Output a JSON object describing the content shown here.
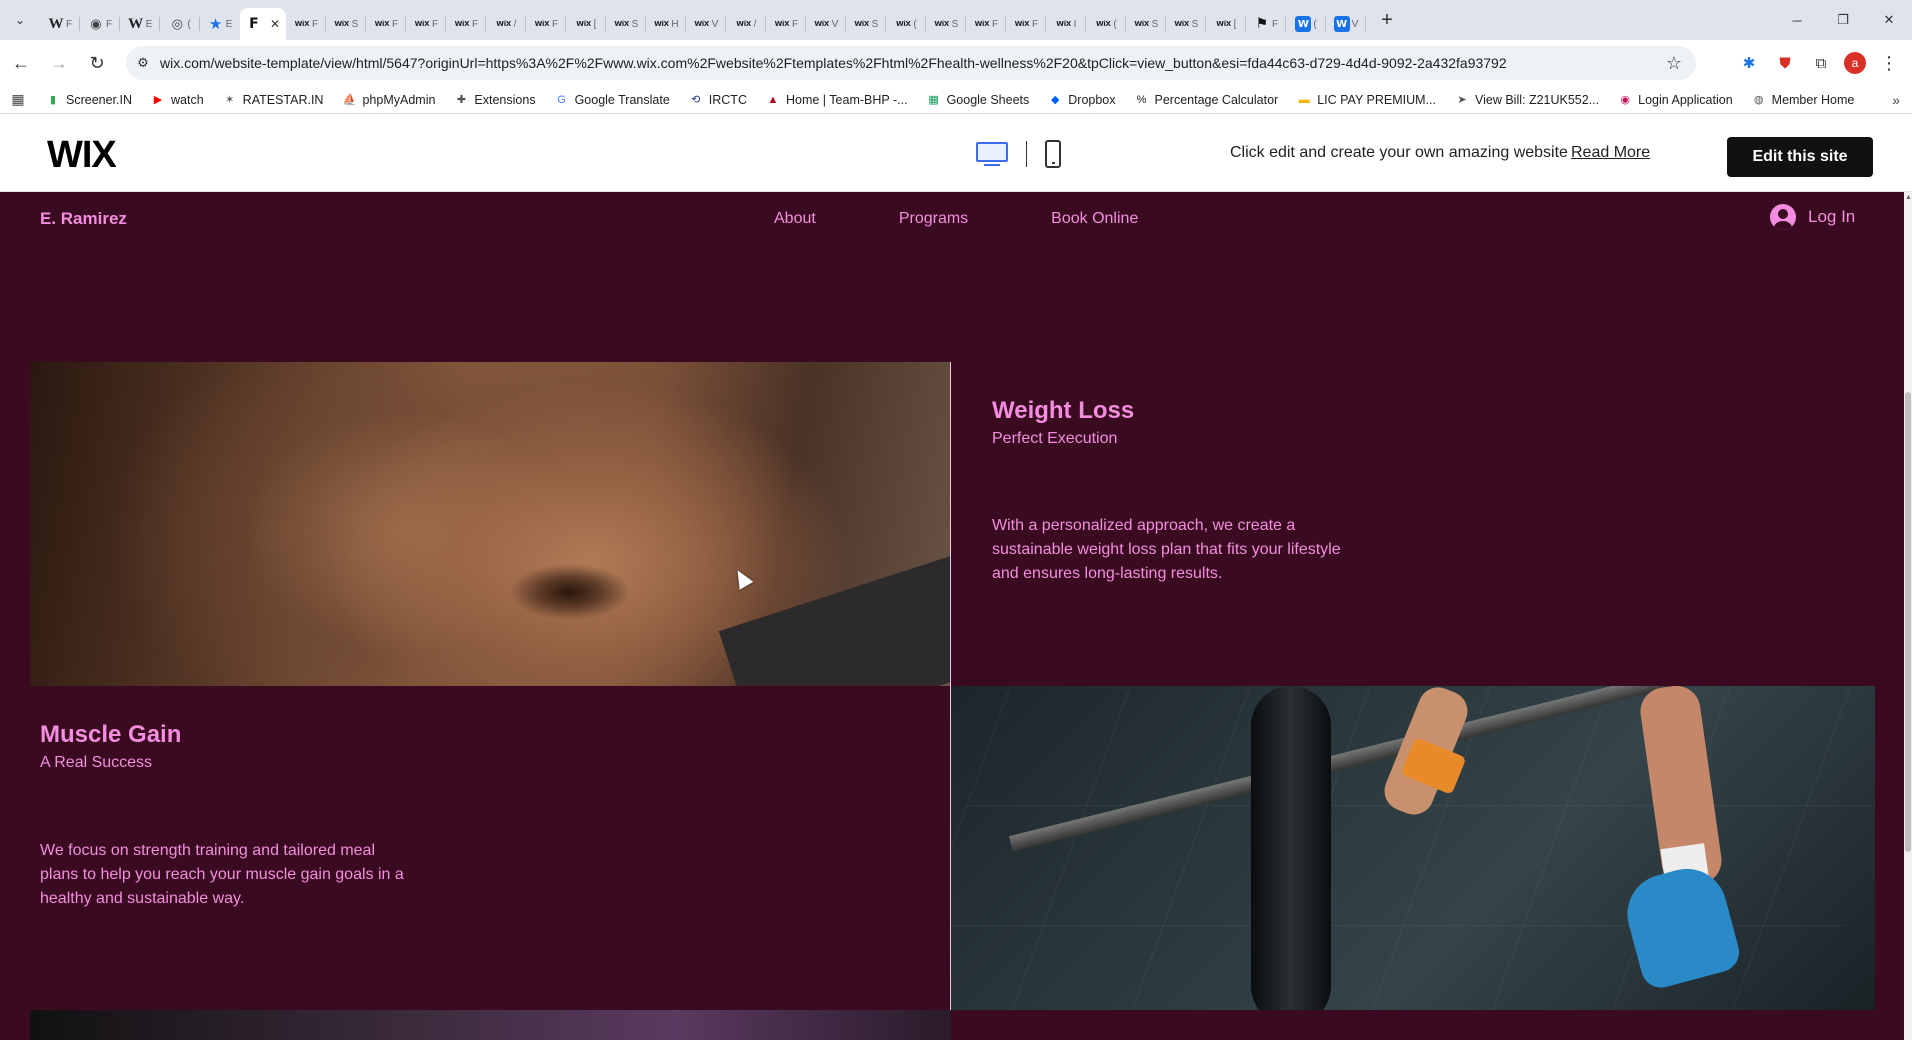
{
  "browser": {
    "tabs": [
      {
        "icon": "W",
        "icon_class": "w",
        "label": "F"
      },
      {
        "icon": "◉",
        "icon_class": "globe",
        "label": "F"
      },
      {
        "icon": "W",
        "icon_class": "w",
        "label": "E"
      },
      {
        "icon": "◎",
        "icon_class": "globe",
        "label": "("
      },
      {
        "icon": "★",
        "icon_class": "star",
        "label": "E"
      },
      {
        "icon": "F",
        "icon_class": "dark",
        "label": "",
        "active": true
      },
      {
        "icon": "WiX",
        "icon_class": "wix",
        "label": "F"
      },
      {
        "icon": "WiX",
        "icon_class": "wix",
        "label": "S"
      },
      {
        "icon": "WiX",
        "icon_class": "wix",
        "label": "F"
      },
      {
        "icon": "WiX",
        "icon_class": "wix",
        "label": "F"
      },
      {
        "icon": "WiX",
        "icon_class": "wix",
        "label": "F"
      },
      {
        "icon": "WiX",
        "icon_class": "wix",
        "label": "/"
      },
      {
        "icon": "WiX",
        "icon_class": "wix",
        "label": "F"
      },
      {
        "icon": "WiX",
        "icon_class": "wix",
        "label": "["
      },
      {
        "icon": "WiX",
        "icon_class": "wix",
        "label": "S"
      },
      {
        "icon": "WiX",
        "icon_class": "wix",
        "label": "H"
      },
      {
        "icon": "WiX",
        "icon_class": "wix",
        "label": "V"
      },
      {
        "icon": "WiX",
        "icon_class": "wix",
        "label": "/"
      },
      {
        "icon": "WiX",
        "icon_class": "wix",
        "label": "F"
      },
      {
        "icon": "WiX",
        "icon_class": "wix",
        "label": "V"
      },
      {
        "icon": "WiX",
        "icon_class": "wix",
        "label": "S"
      },
      {
        "icon": "WiX",
        "icon_class": "wix",
        "label": "("
      },
      {
        "icon": "WiX",
        "icon_class": "wix",
        "label": "S"
      },
      {
        "icon": "WiX",
        "icon_class": "wix",
        "label": "F"
      },
      {
        "icon": "WiX",
        "icon_class": "wix",
        "label": "F"
      },
      {
        "icon": "WiX",
        "icon_class": "wix",
        "label": "I"
      },
      {
        "icon": "WiX",
        "icon_class": "wix",
        "label": "("
      },
      {
        "icon": "WiX",
        "icon_class": "wix",
        "label": "S"
      },
      {
        "icon": "WiX",
        "icon_class": "wix",
        "label": "S"
      },
      {
        "icon": "WiX",
        "icon_class": "wix",
        "label": "["
      },
      {
        "icon": "⚑",
        "icon_class": "dark",
        "label": "F"
      },
      {
        "icon": "W",
        "icon_class": "blue",
        "label": "("
      },
      {
        "icon": "W",
        "icon_class": "blue",
        "label": "V"
      }
    ],
    "url": "wix.com/website-template/view/html/5647?originUrl=https%3A%2F%2Fwww.wix.com%2Fwebsite%2Ftemplates%2Fhtml%2Fhealth-wellness%2F20&tpClick=view_button&esi=fda44c63-d729-4d4d-9092-2a432fa93792",
    "profile_initial": "a",
    "bookmarks": [
      {
        "label": "Screener.IN",
        "icon": "▮",
        "color": "#34a853"
      },
      {
        "label": "watch",
        "icon": "▶",
        "color": "#ff0000"
      },
      {
        "label": "RATESTAR.IN",
        "icon": "✶",
        "color": "#555555"
      },
      {
        "label": "phpMyAdmin",
        "icon": "⛵",
        "color": "#e37400"
      },
      {
        "label": "Extensions",
        "icon": "✚",
        "color": "#555555"
      },
      {
        "label": "Google Translate",
        "icon": "G",
        "color": "#4285f4"
      },
      {
        "label": "IRCTC",
        "icon": "⟲",
        "color": "#1a3a8a"
      },
      {
        "label": "Home | Team-BHP -...",
        "icon": "▲",
        "color": "#b00020"
      },
      {
        "label": "Google Sheets",
        "icon": "▦",
        "color": "#0f9d58"
      },
      {
        "label": "Dropbox",
        "icon": "◆",
        "color": "#0061fe"
      },
      {
        "label": "Percentage Calculator",
        "icon": "%",
        "color": "#222222"
      },
      {
        "label": "LIC PAY PREMIUM...",
        "icon": "▬",
        "color": "#f4b400"
      },
      {
        "label": "View Bill: Z21UK552...",
        "icon": "➤",
        "color": "#555555"
      },
      {
        "label": "Login Application",
        "icon": "◉",
        "color": "#c2185b"
      },
      {
        "label": "Member Home",
        "icon": "◍",
        "color": "#555555"
      }
    ]
  },
  "wix_bar": {
    "logo": "WIX",
    "cta_text": "Click edit and create your own amazing website",
    "read_more": "Read More",
    "edit_button": "Edit this site"
  },
  "site": {
    "brand": "E. Ramirez",
    "nav": [
      "About",
      "Programs",
      "Book Online"
    ],
    "login_label": "Log In",
    "programs": [
      {
        "title": "Weight Loss",
        "subtitle": "Perfect Execution",
        "description_lines": [
          "With a personalized approach, we create a",
          "sustainable weight loss plan that fits your lifestyle",
          "and ensures long-lasting results."
        ]
      },
      {
        "title": "Muscle Gain",
        "subtitle": "A Real Success",
        "description_lines": [
          "We focus on strength training and tailored meal",
          "plans to help you reach your muscle gain goals in a",
          "healthy and sustainable way."
        ]
      }
    ]
  },
  "colors": {
    "site_bg": "#3a0a20",
    "accent_pink": "#f48de0",
    "wix_button": "#111111",
    "browser_chrome": "#dfe3eb"
  }
}
